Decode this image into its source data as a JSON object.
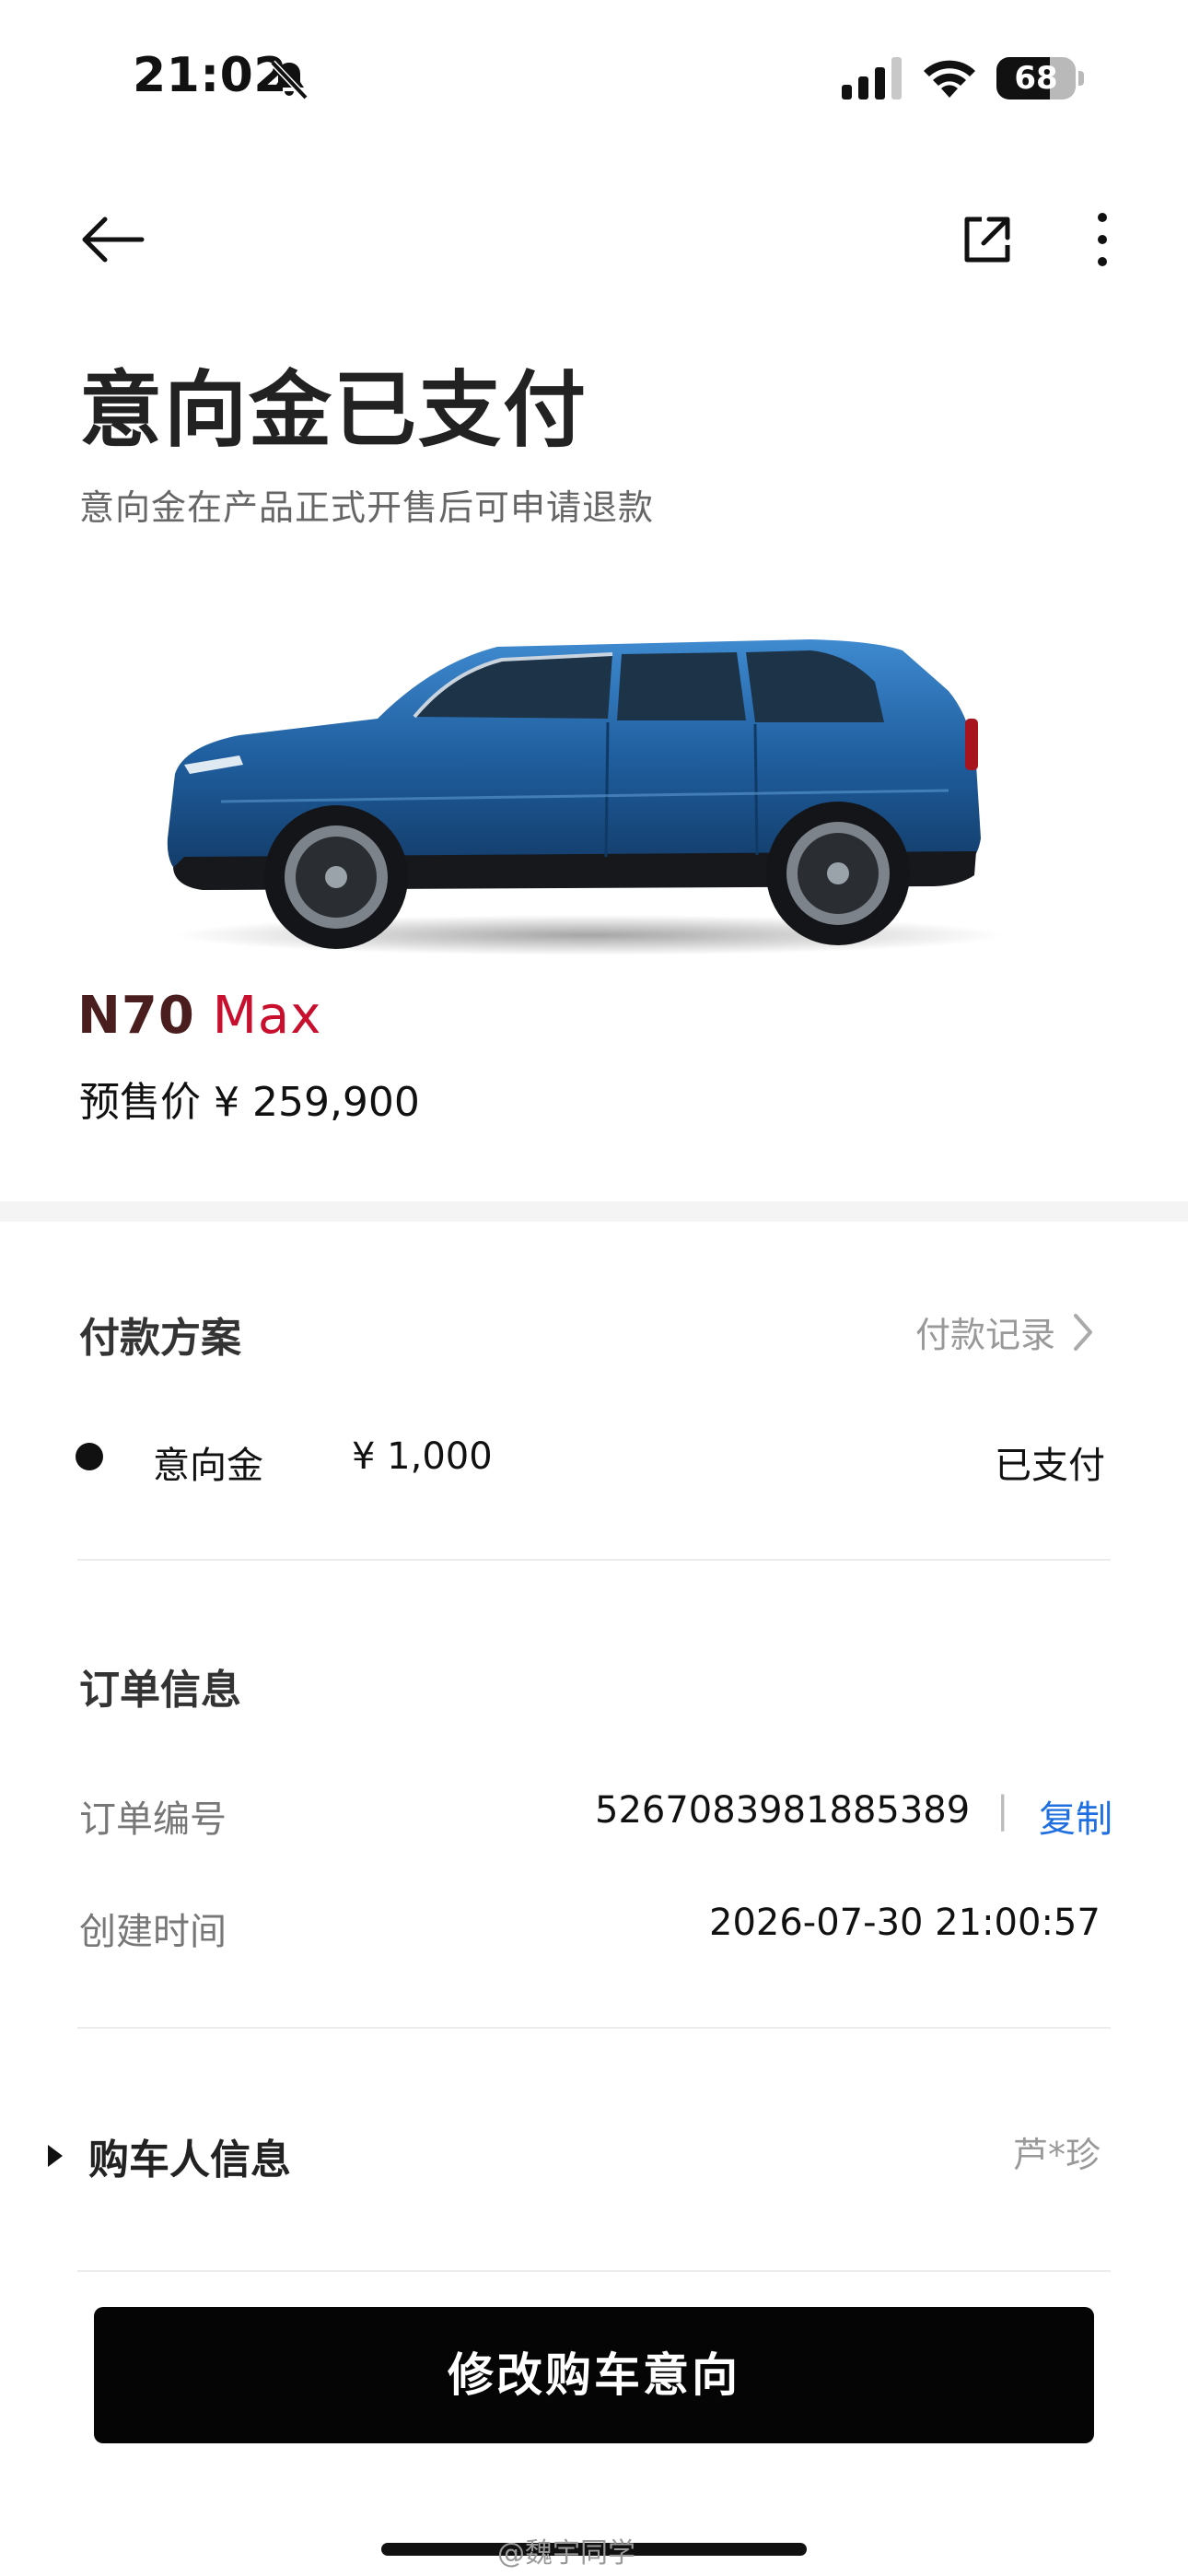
{
  "status_bar": {
    "time": "21:02",
    "battery": "68",
    "battery_level_percent": 68
  },
  "page": {
    "title": "意向金已支付",
    "subtitle": "意向金在产品正式开售后可申请退款"
  },
  "product": {
    "model_prefix": "N70",
    "model_suffix": " Max",
    "price_text": "预售价 ¥ 259,900"
  },
  "payment_plan": {
    "title": "付款方案",
    "records_link": "付款记录",
    "items": [
      {
        "name": "意向金",
        "amount": "¥ 1,000",
        "status": "已支付"
      }
    ]
  },
  "order_info": {
    "title": "订单信息",
    "rows": [
      {
        "label": "订单编号",
        "value": "5267083981885389",
        "separator": "|",
        "action": "复制"
      },
      {
        "label": "创建时间",
        "value": "2026-07-30 21:00:57"
      }
    ]
  },
  "buyer": {
    "title": "购车人信息",
    "name": "芦*珍"
  },
  "cta": {
    "label": "修改购车意向"
  },
  "watermark": "@魏宇同学",
  "colors": {
    "accent_blue": "#1f6fe0",
    "brand_red": "#c8102e",
    "brand_dark": "#4a1e1e",
    "car_blue": "#1f5e9e"
  }
}
